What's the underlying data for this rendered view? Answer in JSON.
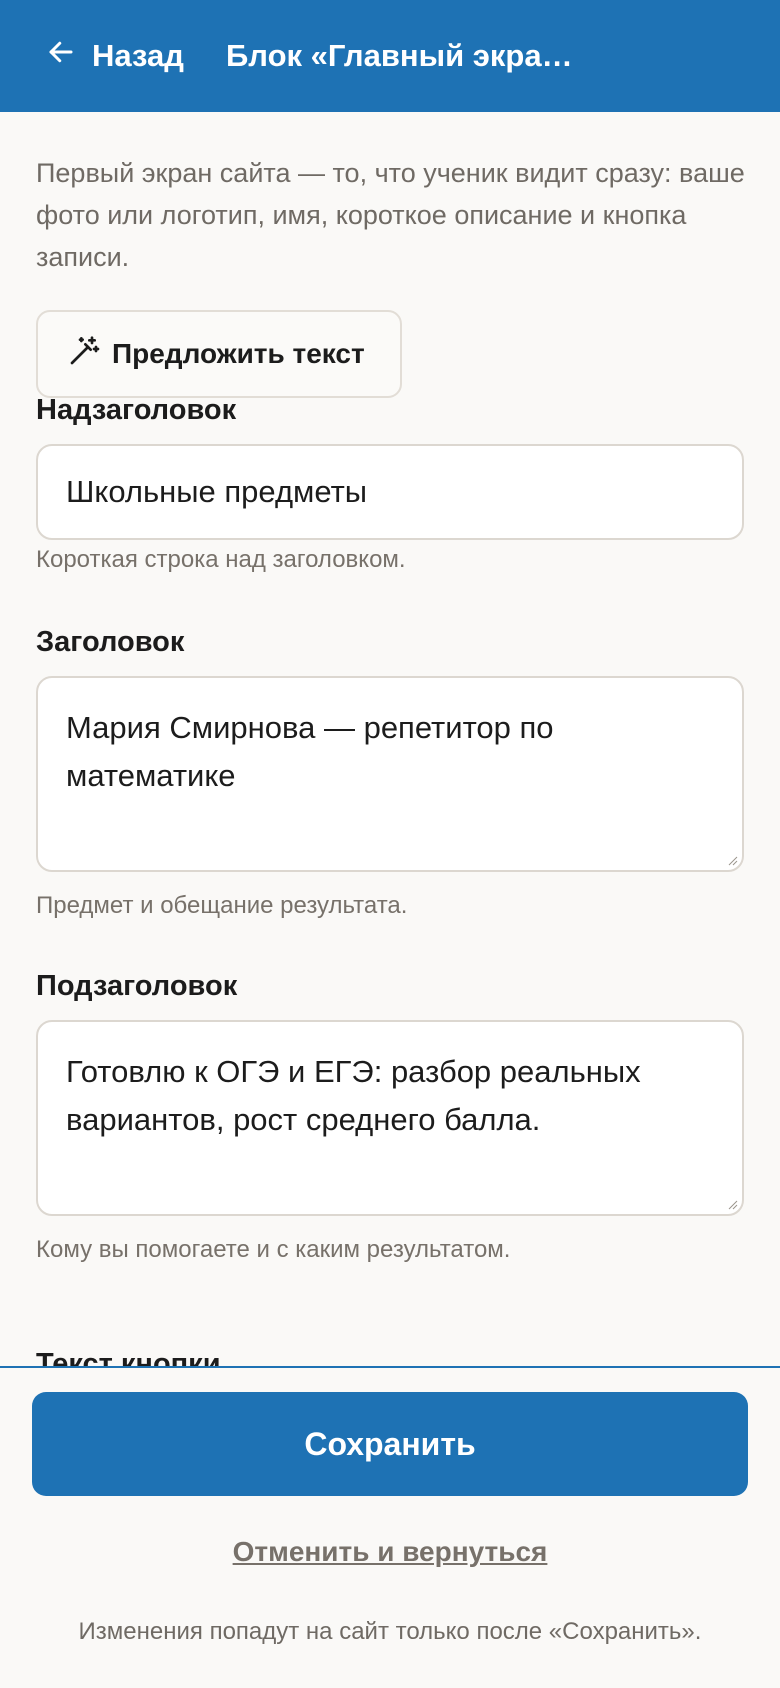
{
  "header": {
    "back_label": "Назад",
    "title": "Блок «Главный экра…",
    "background": "#1e72b4"
  },
  "intro_text": "Первый экран сайта — то, что ученик видит сразу: ваше фото или логотип, имя, короткое описание и кнопка записи.",
  "suggest_button": {
    "label": "Предложить текст",
    "icon": "magic-wand-icon"
  },
  "fields": {
    "overtitle": {
      "label": "Надзаголовок",
      "value": "Школьные предметы",
      "hint": "Короткая строка над заголовком."
    },
    "title": {
      "label": "Заголовок",
      "value": "Мария Смирнова — репетитор по математике",
      "hint": "Предмет и обещание результата."
    },
    "subtitle": {
      "label": "Подзаголовок",
      "value": "Готовлю к ОГЭ и ЕГЭ: разбор реальных вариантов, рост среднего балла.",
      "hint": "Кому вы помогаете и с каким результатом."
    },
    "button_text": {
      "label": "Текст кнопки"
    }
  },
  "footer": {
    "save_label": "Сохранить",
    "cancel_label": "Отменить и вернуться",
    "note": "Изменения попадут на сайт только после «Сохранить».",
    "accent": "#1e72b4"
  }
}
